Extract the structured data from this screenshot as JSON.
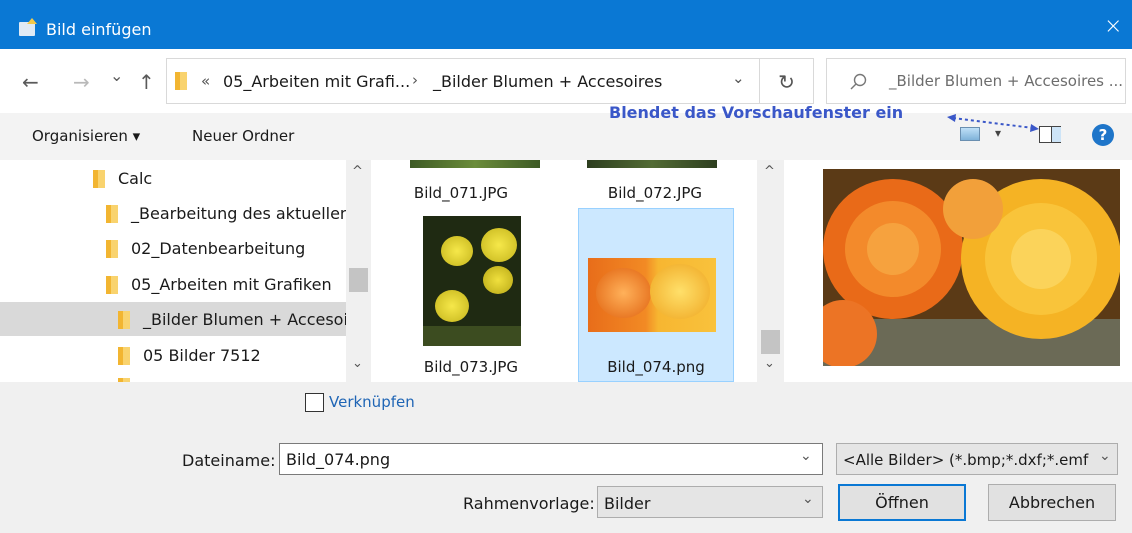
{
  "window": {
    "title": "Bild einfügen",
    "close_icon": "×"
  },
  "nav": {
    "back_icon": "←",
    "forward_icon": "→",
    "recent_icon": "⌄",
    "up_icon": "↑",
    "breadcrumb_overflow": "«",
    "breadcrumb_1": "05_Arbeiten mit Grafi...",
    "breadcrumb_sep": "›",
    "breadcrumb_2": "_Bilder Blumen + Accesoires",
    "address_dropdown_icon": "⌄",
    "refresh_icon": "↻",
    "search_placeholder": "_Bilder Blumen + Accesoires ..."
  },
  "toolbar": {
    "organize": "Organisieren ▾",
    "new_folder": "Neuer Ordner",
    "annotation": "Blendet das Vorschaufenster ein",
    "view_dropdown": "▾",
    "help": "?"
  },
  "tree": {
    "items": [
      {
        "label": "Calc"
      },
      {
        "label": "_Bearbeitung des aktuellen"
      },
      {
        "label": "02_Datenbearbeitung"
      },
      {
        "label": "05_Arbeiten mit Grafiken"
      },
      {
        "label": "_Bilder Blumen + Accesoir"
      },
      {
        "label": "05 Bilder 7512"
      }
    ]
  },
  "files": [
    {
      "name": "Bild_071.JPG"
    },
    {
      "name": "Bild_072.JPG"
    },
    {
      "name": "Bild_073.JPG"
    },
    {
      "name": "Bild_074.png"
    }
  ],
  "scroll_up": "^",
  "scroll_down": "⌄",
  "bottom": {
    "link_label": "Verknüpfen",
    "filename_label": "Dateiname:",
    "filename_value": "Bild_074.png",
    "filetype_value": "<Alle Bilder> (*.bmp;*.dxf;*.emf",
    "frame_label": "Rahmenvorlage:",
    "frame_value": "Bilder",
    "open_button": "Öffnen",
    "cancel_button": "Abbrechen",
    "dropdown_icon": "⌄"
  },
  "colors": {
    "titlebar": "#0a78d4",
    "annotation": "#3a57c8",
    "selection": "#cce8ff"
  }
}
